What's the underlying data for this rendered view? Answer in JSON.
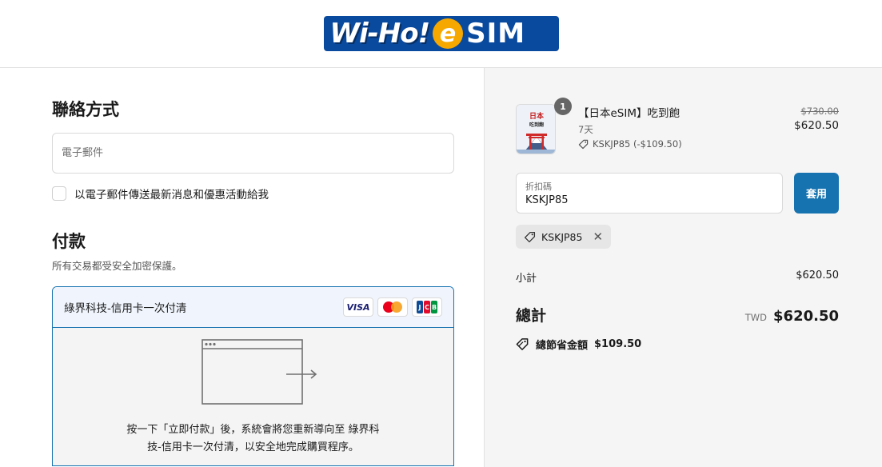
{
  "header": {
    "logo_text_1": "Wi-Ho!",
    "logo_text_2": "e",
    "logo_text_3": "SIM"
  },
  "contact": {
    "title": "聯絡方式",
    "email_placeholder": "電子郵件",
    "newsletter_label": "以電子郵件傳送最新消息和優惠活動給我"
  },
  "payment": {
    "title": "付款",
    "subtitle": "所有交易都受安全加密保護。",
    "method_label": "綠界科技-信用卡一次付清",
    "cards": [
      "visa",
      "mastercard",
      "jcb"
    ],
    "visa_text": "VISA",
    "redirect_line1": "按一下「立即付款」後，系統會將您重新導向至 綠界科",
    "redirect_line2": "技-信用卡一次付清，以安全地完成購買程序。"
  },
  "summary": {
    "product": {
      "quantity": "1",
      "name": "【日本eSIM】吃到飽",
      "variant": "7天",
      "discount": "KSKJP85 (-$109.50)",
      "price_original": "$730.00",
      "price_final": "$620.50",
      "thumb_text_1": "日本",
      "thumb_text_2": "吃到飽"
    },
    "discount_code": {
      "label": "折扣碼",
      "value": "KSKJP85",
      "apply_label": "套用"
    },
    "applied_chip": "KSKJP85",
    "subtotal_label": "小計",
    "subtotal_value": "$620.50",
    "total_label": "總計",
    "total_currency": "TWD",
    "total_value": "$620.50",
    "savings_label": "總節省金額",
    "savings_value": "$109.50"
  },
  "colors": {
    "accent": "#1773b0",
    "logo_blue": "#0a4a9e",
    "logo_orange": "#f6a800"
  }
}
